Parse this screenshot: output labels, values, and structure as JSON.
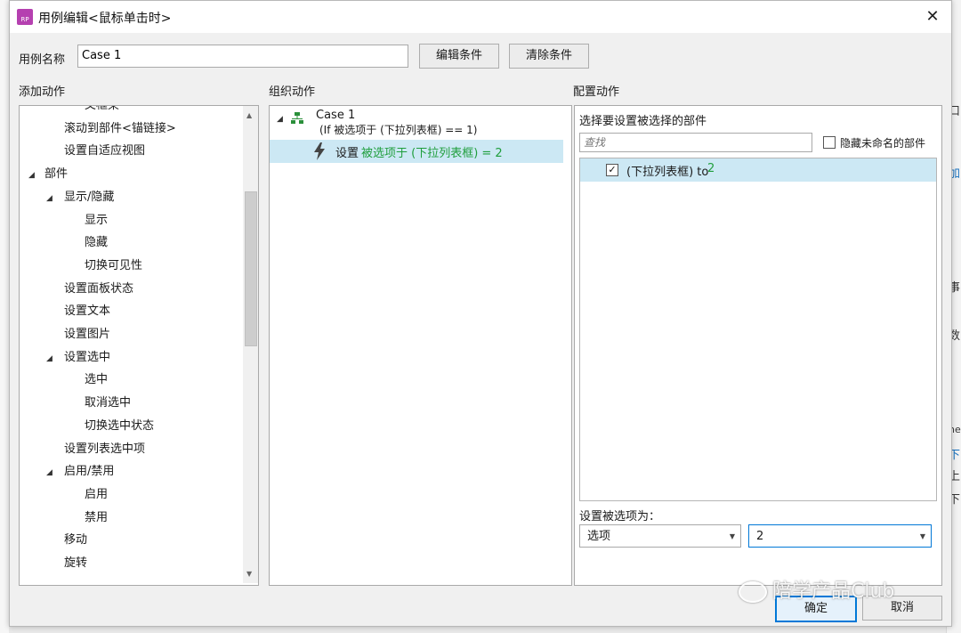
{
  "dialog": {
    "title": "用例编辑<鼠标单击时>",
    "app_icon": "RP",
    "close_glyph": "✕"
  },
  "case_name": {
    "label": "用例名称",
    "value": "Case 1"
  },
  "buttons": {
    "edit_condition": "编辑条件",
    "clear_condition": "清除条件",
    "ok": "确定",
    "cancel": "取消"
  },
  "columns": {
    "add_action": "添加动作",
    "organize_action": "组织动作",
    "configure_action": "配置动作"
  },
  "add_action_tree": [
    {
      "label": "父框架",
      "indent": 3,
      "expander": ""
    },
    {
      "label": "滚动到部件<锚链接>",
      "indent": 2,
      "expander": ""
    },
    {
      "label": "设置自适应视图",
      "indent": 2,
      "expander": ""
    },
    {
      "label": "部件",
      "indent": 1,
      "expander": "◢"
    },
    {
      "label": "显示/隐藏",
      "indent": 2,
      "expander": "◢"
    },
    {
      "label": "显示",
      "indent": 3,
      "expander": ""
    },
    {
      "label": "隐藏",
      "indent": 3,
      "expander": ""
    },
    {
      "label": "切换可见性",
      "indent": 3,
      "expander": ""
    },
    {
      "label": "设置面板状态",
      "indent": 2,
      "expander": ""
    },
    {
      "label": "设置文本",
      "indent": 2,
      "expander": ""
    },
    {
      "label": "设置图片",
      "indent": 2,
      "expander": ""
    },
    {
      "label": "设置选中",
      "indent": 2,
      "expander": "◢"
    },
    {
      "label": "选中",
      "indent": 3,
      "expander": ""
    },
    {
      "label": "取消选中",
      "indent": 3,
      "expander": ""
    },
    {
      "label": "切换选中状态",
      "indent": 3,
      "expander": ""
    },
    {
      "label": "设置列表选中项",
      "indent": 2,
      "expander": ""
    },
    {
      "label": "启用/禁用",
      "indent": 2,
      "expander": "◢"
    },
    {
      "label": "启用",
      "indent": 3,
      "expander": ""
    },
    {
      "label": "禁用",
      "indent": 3,
      "expander": ""
    },
    {
      "label": "移动",
      "indent": 2,
      "expander": ""
    },
    {
      "label": "旋转",
      "indent": 2,
      "expander": ""
    }
  ],
  "organize": {
    "case_label": "Case 1",
    "condition": "(If 被选项于 (下拉列表框) == 1)",
    "action_prefix": "设置",
    "action_detail": "被选项于 (下拉列表框) = 2"
  },
  "configure": {
    "select_widget_label": "选择要设置被选择的部件",
    "search_placeholder": "查找",
    "hide_unnamed_label": "隐藏未命名的部件",
    "hide_unnamed_checked": false,
    "widget_item_name": "(下拉列表框) to",
    "widget_item_value": "2",
    "widget_item_checked": true,
    "set_selected_label": "设置被选项为：",
    "type_select_value": "选项",
    "value_select_value": "2"
  },
  "watermark": "陪学产品Club",
  "background_edge": [
    "口",
    "加",
    "事",
    "数",
    "ne",
    "下",
    "上",
    "下"
  ],
  "colors": {
    "accent_green": "#1f9e3c",
    "selection_blue": "#cce8f4",
    "focus_blue": "#0078d7"
  }
}
